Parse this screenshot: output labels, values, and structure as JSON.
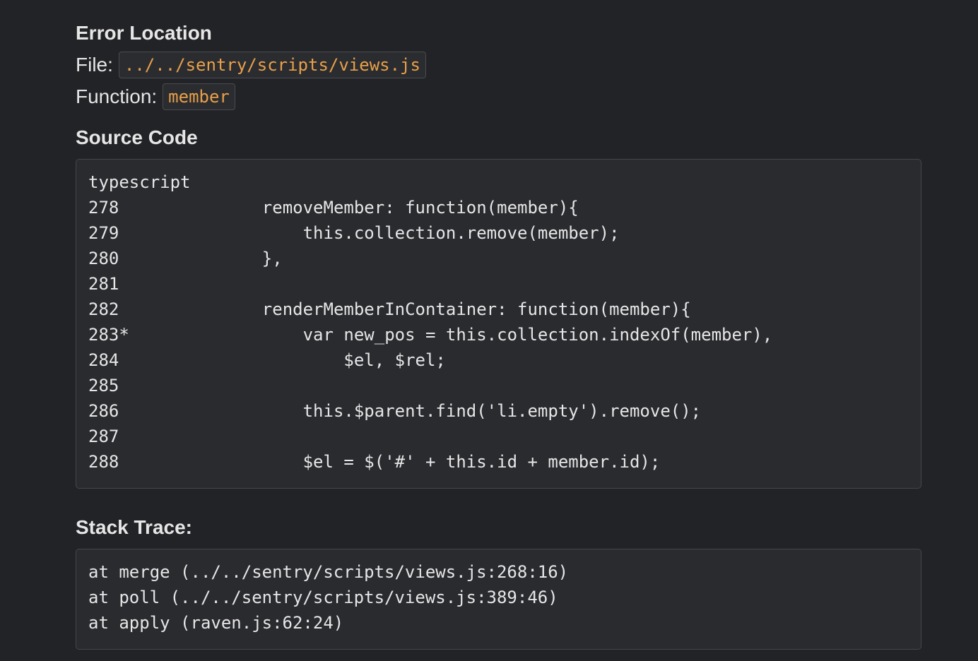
{
  "error_location": {
    "heading": "Error Location",
    "file_label": "File:",
    "file_value": "../../sentry/scripts/views.js",
    "function_label": "Function:",
    "function_value": "member"
  },
  "source_code": {
    "heading": "Source Code",
    "language": "typescript",
    "lines": [
      {
        "number": "278",
        "code": "    removeMember: function(member){"
      },
      {
        "number": "279",
        "code": "        this.collection.remove(member);"
      },
      {
        "number": "280",
        "code": "    },"
      },
      {
        "number": "281",
        "code": ""
      },
      {
        "number": "282",
        "code": "    renderMemberInContainer: function(member){"
      },
      {
        "number": "283*",
        "code": "        var new_pos = this.collection.indexOf(member),"
      },
      {
        "number": "284",
        "code": "            $el, $rel;"
      },
      {
        "number": "285",
        "code": ""
      },
      {
        "number": "286",
        "code": "        this.$parent.find('li.empty').remove();"
      },
      {
        "number": "287",
        "code": ""
      },
      {
        "number": "288",
        "code": "        $el = $('#' + this.id + member.id);"
      }
    ]
  },
  "stack_trace": {
    "heading": "Stack Trace:",
    "frames": [
      "at merge (../../sentry/scripts/views.js:268:16)",
      "at poll (../../sentry/scripts/views.js:389:46)",
      "at apply (raven.js:62:24)"
    ]
  },
  "colors": {
    "background": "#222326",
    "code_background": "#2a2b2f",
    "chip_text": "#e8a04a",
    "text": "#e6e6e6"
  }
}
